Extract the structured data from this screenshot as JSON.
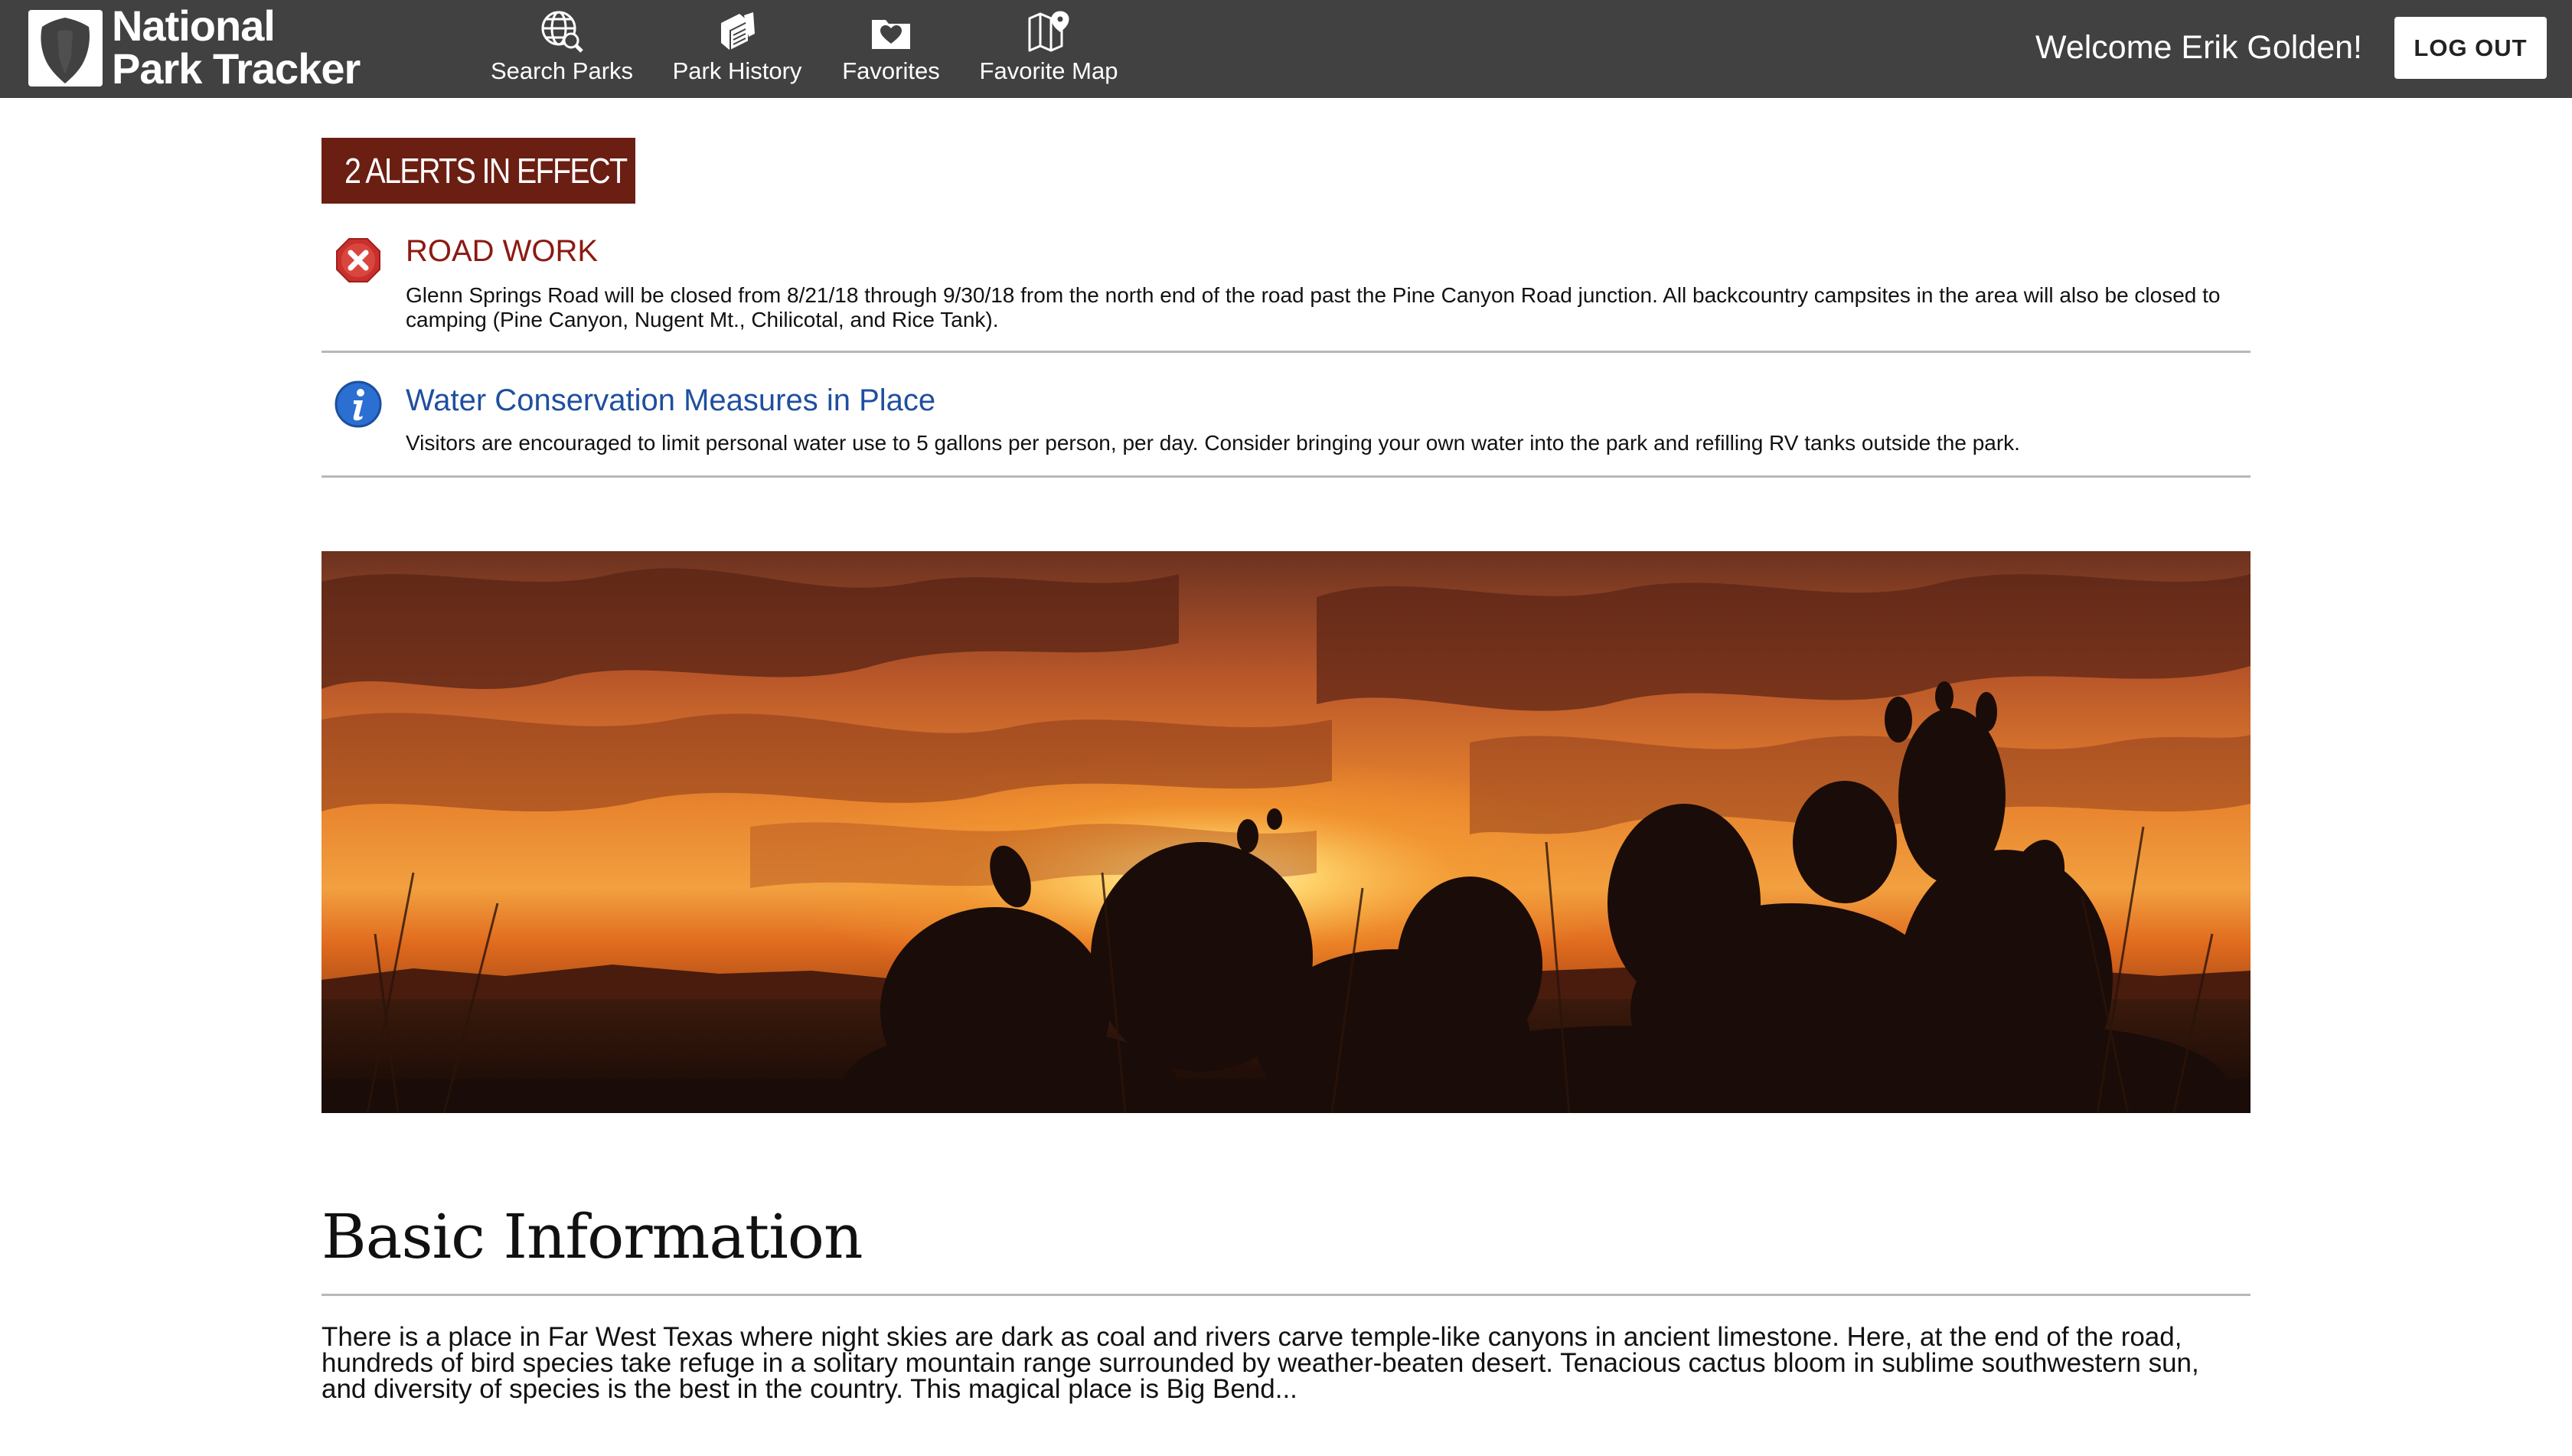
{
  "header": {
    "brand_line1": "National",
    "brand_line2": "Park Tracker",
    "brand_icon": "arrowhead-logo",
    "nav": [
      {
        "label": "Search Parks",
        "icon": "globe-search-icon"
      },
      {
        "label": "Park History",
        "icon": "books-icon"
      },
      {
        "label": "Favorites",
        "icon": "heart-folder-icon"
      },
      {
        "label": "Favorite Map",
        "icon": "map-pin-icon"
      }
    ],
    "welcome": "Welcome Erik Golden!",
    "logout_label": "LOG OUT"
  },
  "alerts": {
    "badge": "2 ALERTS IN EFFECT",
    "items": [
      {
        "type": "danger",
        "icon": "close-circle-icon",
        "title": "ROAD WORK",
        "body": "Glenn Springs Road will be closed from 8/21/18 through 9/30/18 from the north end of the road past the Pine Canyon Road junction. All backcountry campsites in the area will also be closed to camping (Pine Canyon, Nugent Mt., Chilicotal, and Rice Tank)."
      },
      {
        "type": "info",
        "icon": "info-circle-icon",
        "title": "Water Conservation Measures in Place",
        "body": "Visitors are encouraged to limit personal water use to 5 gallons per person, per day. Consider bringing your own water into the park and refilling RV tanks outside the park."
      }
    ]
  },
  "hero": {
    "image": "sunset-cactus-silhouette"
  },
  "basic_info": {
    "heading": "Basic Information",
    "body": "There is a place in Far West Texas where night skies are dark as coal and rivers carve temple-like canyons in ancient limestone. Here, at the end of the road, hundreds of bird species take refuge in a solitary mountain range surrounded by weather-beaten desert. Tenacious cactus bloom in sublime southwestern sun, and diversity of species is the best in the country. This magical place is Big Bend..."
  },
  "colors": {
    "navbar": "#414141",
    "alert_badge": "#6b1e12",
    "danger_title": "#8b1a12",
    "info_title": "#1f4f9e",
    "divider": "#b8b8b8"
  }
}
